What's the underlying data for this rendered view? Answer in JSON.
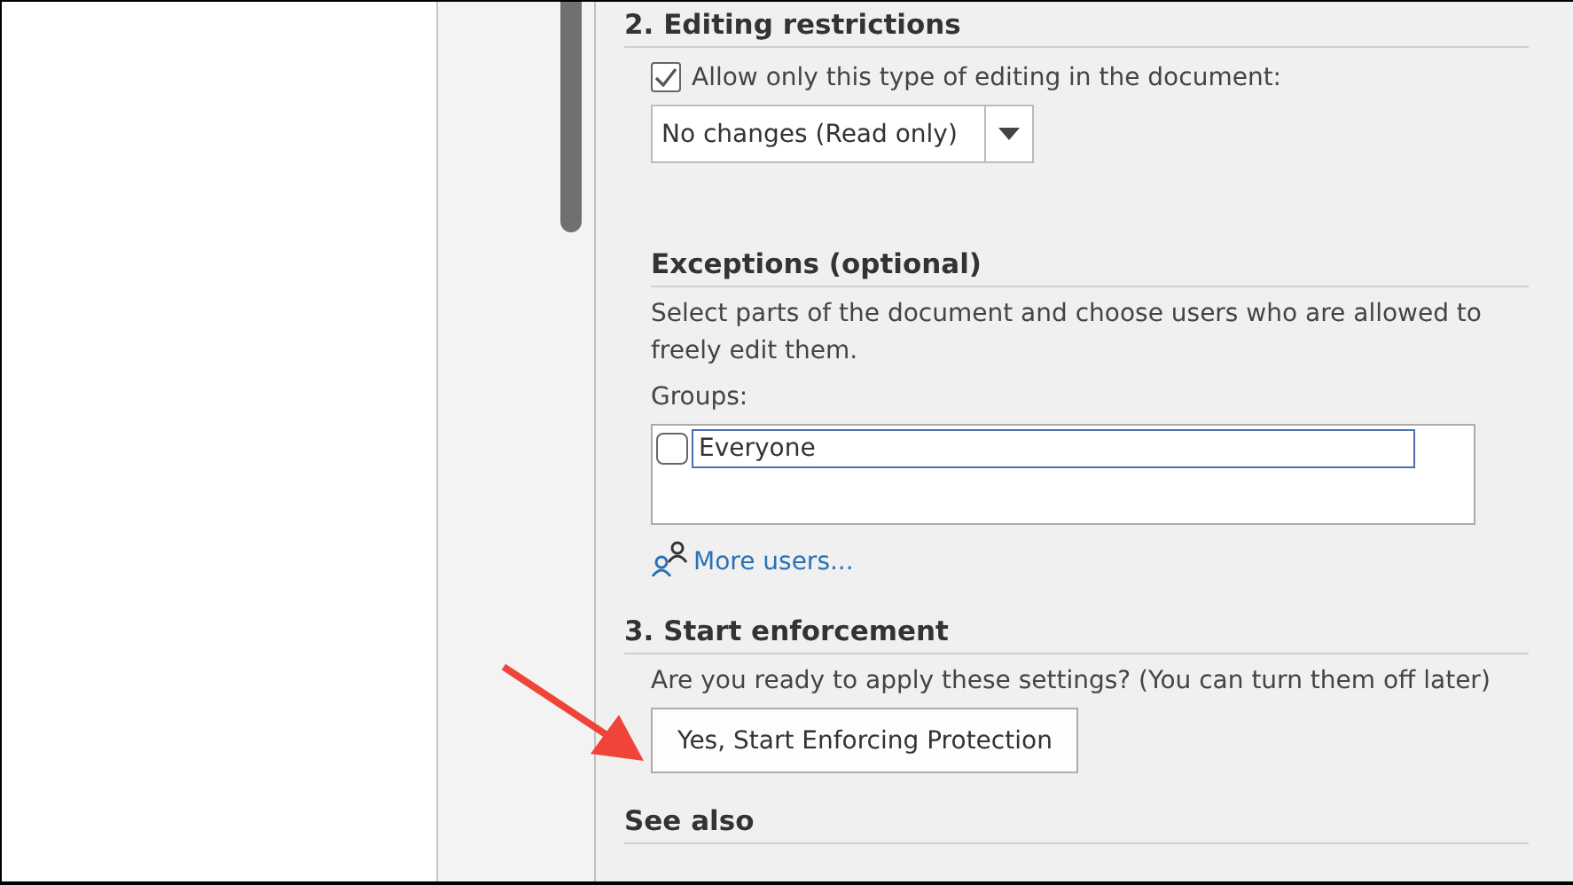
{
  "editing_restrictions": {
    "heading": "2. Editing restrictions",
    "checkbox": {
      "label": "Allow only this type of editing in the document:",
      "checked": true
    },
    "dropdown": {
      "value": "No changes (Read only)"
    }
  },
  "exceptions": {
    "heading": "Exceptions (optional)",
    "description": "Select parts of the document and choose users who are allowed to freely edit them.",
    "groups_label": "Groups:",
    "groups": [
      {
        "name": "Everyone",
        "checked": false
      }
    ],
    "more_users": "More users..."
  },
  "start_enforcement": {
    "heading": "3. Start enforcement",
    "question": "Are you ready to apply these settings? (You can turn them off later)",
    "button": "Yes, Start Enforcing Protection"
  },
  "see_also": {
    "heading": "See also"
  }
}
